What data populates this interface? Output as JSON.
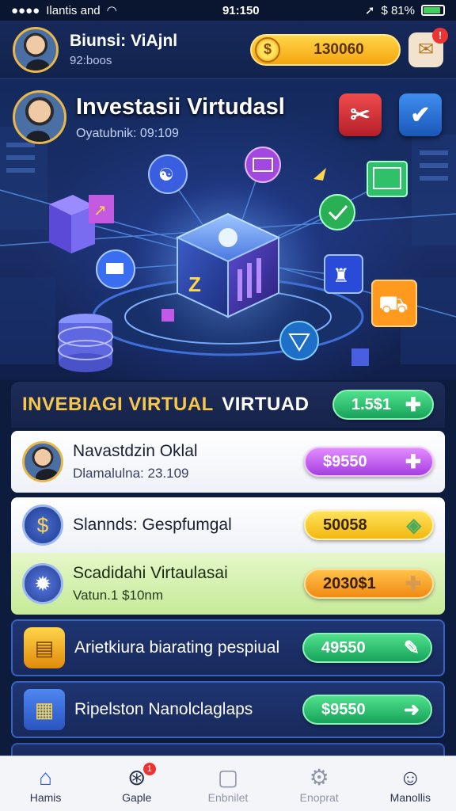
{
  "status_bar": {
    "carrier": "Ilantis and",
    "time": "91:150",
    "battery": "$ 81%",
    "icons": [
      "signal-dots-icon",
      "wifi-icon",
      "location-arrow-icon",
      "battery-icon"
    ]
  },
  "header": {
    "name": "Biunsi: ViAjnl",
    "sub": "92:boos",
    "coins": "130060",
    "mail_badge": "!"
  },
  "hero": {
    "title": "Investasii Virtudasl",
    "subtitle": "Oyatubnik: 09:109",
    "icons": [
      "tools-icon",
      "check-icon",
      "building-icon",
      "database-icon",
      "money-bag-icon",
      "chart-icon",
      "cart-icon",
      "target-icon",
      "truck-icon",
      "vault-cube-icon"
    ]
  },
  "section": {
    "title": "INVEBIAGI VIRTUAL",
    "title_accent": "VIRTUAD",
    "value": "1.5$1"
  },
  "cards": [
    {
      "title": "Navastdzin Oklal",
      "sub": "Dlamalulna: 23.109",
      "value": "$9550",
      "style": "light",
      "icon": "avatar"
    },
    {
      "title": "Slannds: Gespfumgal",
      "sub": "",
      "value": "50058",
      "style": "light",
      "icon": "dollar-cycle-icon"
    },
    {
      "title": "Scadidahi Virtaulasai",
      "sub": "Vatun.1 $10nm",
      "value": "2030$1",
      "style": "lime",
      "icon": "gear-icon"
    },
    {
      "title": "Arietkiura biarating pespiual",
      "sub": "",
      "value": "49550",
      "style": "dark",
      "icon": "gold-bars-icon"
    },
    {
      "title": "Ripelston Nanolclaglaps",
      "sub": "",
      "value": "$9550",
      "style": "dark",
      "icon": "documents-coin-icon"
    }
  ],
  "nav": [
    {
      "label": "Hamis",
      "icon": "home-icon"
    },
    {
      "label": "Gaple",
      "icon": "game-icon",
      "badge": "1"
    },
    {
      "label": "Enbnilet",
      "icon": "wallet-icon"
    },
    {
      "label": "Enoprat",
      "icon": "settings-gear-icon"
    },
    {
      "label": "Manollis",
      "icon": "profile-icon"
    }
  ],
  "colors": {
    "background": "#0d1b3d",
    "accent_gold": "#f5c84b",
    "green_pill": "#17a35a",
    "purple_pill": "#a43ee0",
    "yellow_pill": "#f2b80f",
    "orange_pill": "#f08a12"
  }
}
